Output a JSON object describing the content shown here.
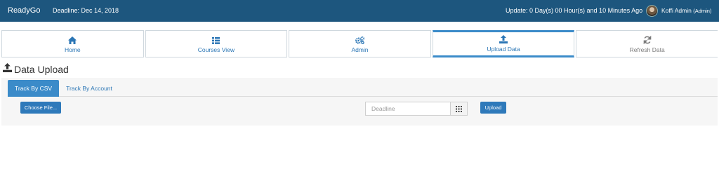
{
  "header": {
    "brand": "ReadyGo",
    "deadline": "Deadline: Dec 14, 2018",
    "update": "Update: 0 Day(s) 00 Hour(s) and 10 Minutes Ago",
    "user_name": "Koffi Admin",
    "user_role": "(Admin)",
    "bar_color": "#1d567e"
  },
  "nav": {
    "tiles": [
      {
        "label": "Home",
        "icon": "home-icon"
      },
      {
        "label": "Courses View",
        "icon": "list-icon"
      },
      {
        "label": "Admin",
        "icon": "gears-icon"
      },
      {
        "label": "Upload Data",
        "icon": "upload-icon",
        "active": true
      },
      {
        "label": "Refresh Data",
        "icon": "refresh-icon"
      }
    ],
    "accent_color": "#3b8bc9"
  },
  "page": {
    "title": "Data Upload",
    "title_icon": "upload-icon"
  },
  "upload_panel": {
    "tabs": [
      {
        "label": "Track By CSV",
        "active": true
      },
      {
        "label": "Track By Account"
      }
    ],
    "choose_file_label": "Choose File...",
    "deadline_placeholder": "Deadline",
    "deadline_value": "",
    "calendar_icon": "calendar-grid-icon",
    "upload_label": "Upload"
  }
}
